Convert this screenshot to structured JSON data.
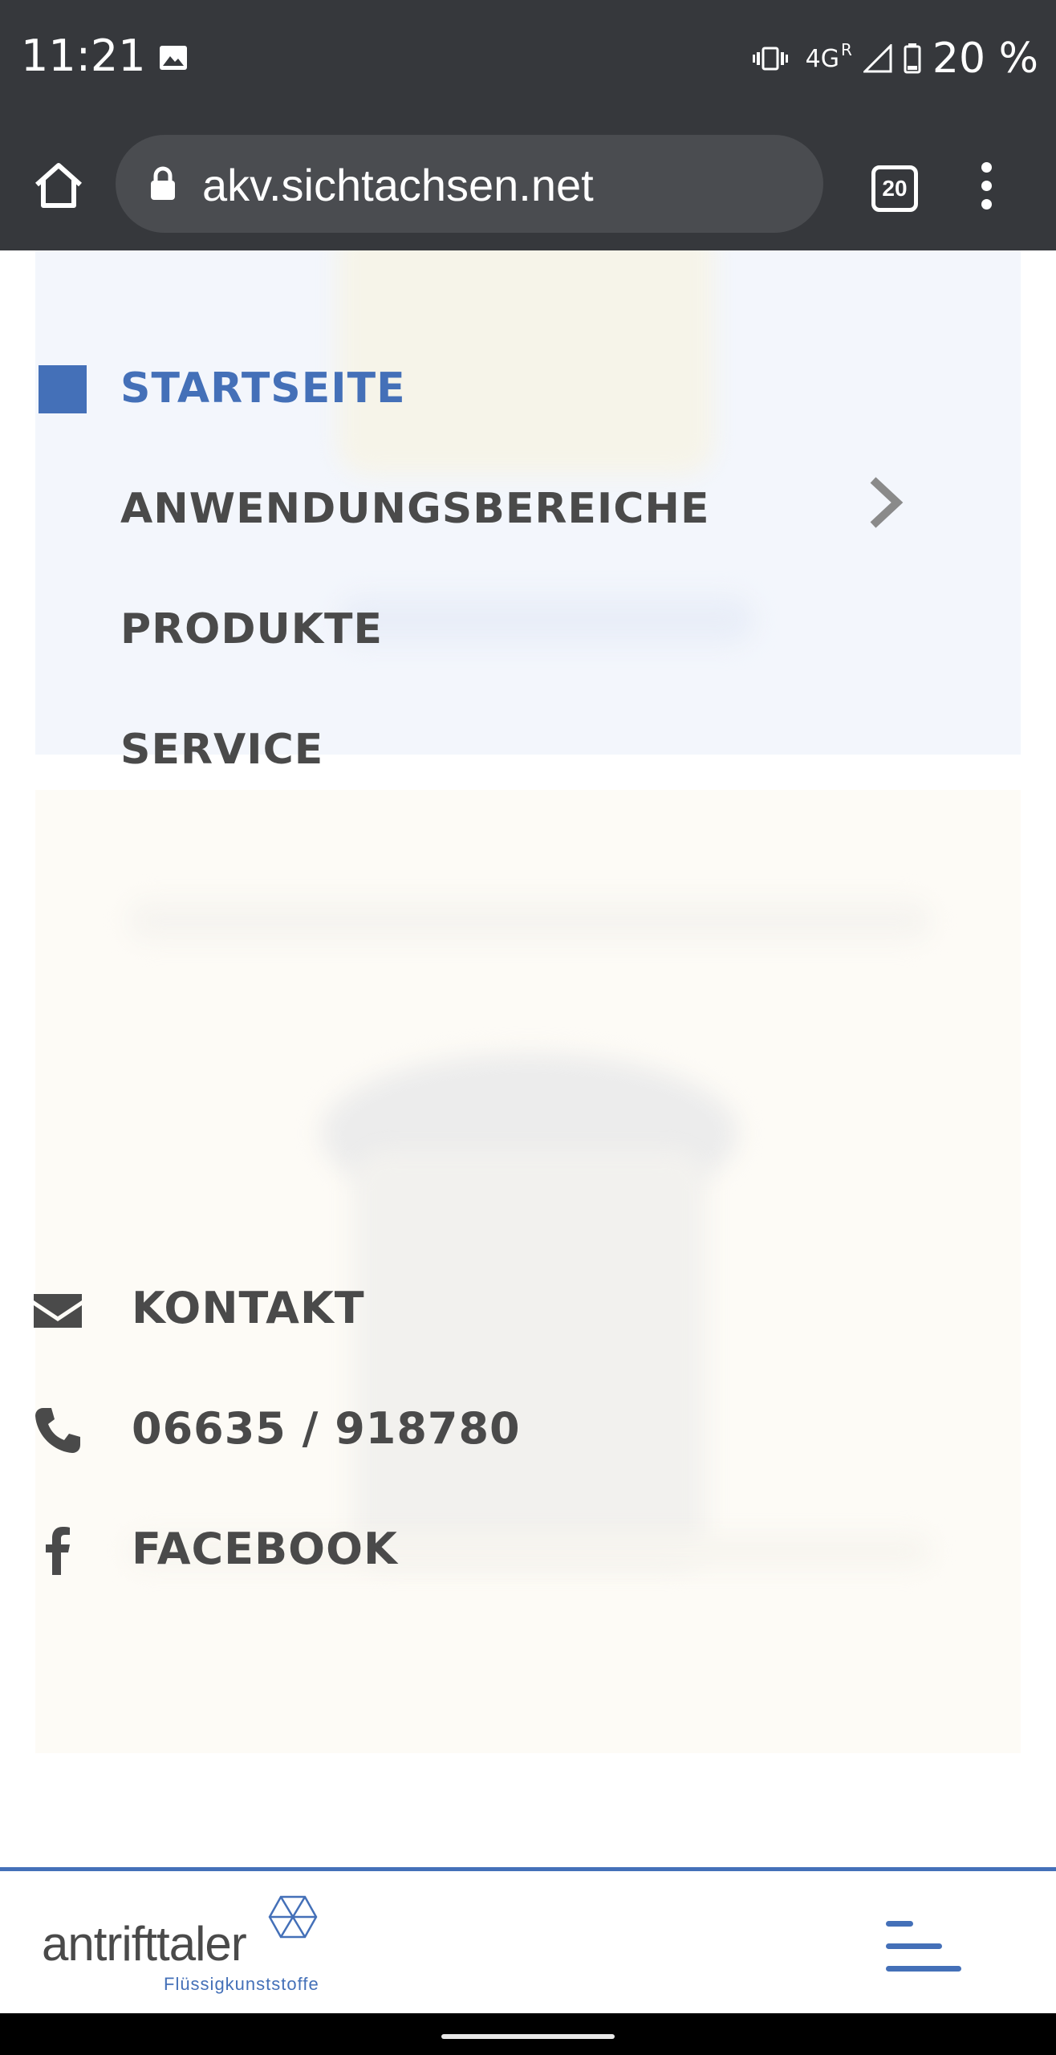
{
  "status_bar": {
    "time": "11:21",
    "network": "4G",
    "roaming": "R",
    "battery": "20 %"
  },
  "browser": {
    "url": "akv.sichtachsen.net",
    "tab_count": "20"
  },
  "nav": {
    "items": [
      {
        "label": "STARTSEITE",
        "active": true
      },
      {
        "label": "ANWENDUNGSBEREICHE",
        "has_submenu": true
      },
      {
        "label": "PRODUKTE"
      },
      {
        "label": "SERVICE"
      }
    ]
  },
  "contact": {
    "email_label": "KONTAKT",
    "phone_label": "06635 / 918780",
    "facebook_label": "FACEBOOK"
  },
  "brand": {
    "name": "antrifttaler",
    "tagline": "Flüssigkunststoffe",
    "accent_color": "#4470b8",
    "text_color": "#4a4a4a"
  }
}
